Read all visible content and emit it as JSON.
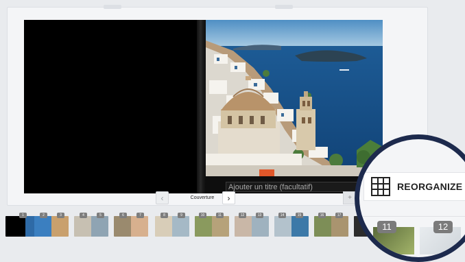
{
  "spread": {
    "title_placeholder": "Ajouter un titre (facultatif)"
  },
  "navigation": {
    "prev_icon": "chevron-left-icon",
    "next_icon": "chevron-right-icon",
    "page_label": "Couverture",
    "prev_glyph": "‹",
    "next_glyph": "›"
  },
  "add_page": {
    "icon": "add-page-icon",
    "glyph": "+"
  },
  "thumbnails": [
    {
      "left_num": "",
      "right_num": "1"
    },
    {
      "left_num": "2",
      "right_num": "3"
    },
    {
      "left_num": "4",
      "right_num": "5"
    },
    {
      "left_num": "6",
      "right_num": "7"
    },
    {
      "left_num": "8",
      "right_num": "9"
    },
    {
      "left_num": "10",
      "right_num": "11"
    },
    {
      "left_num": "12",
      "right_num": "13"
    },
    {
      "left_num": "14",
      "right_num": "15"
    },
    {
      "left_num": "16",
      "right_num": "17"
    },
    {
      "left_num": "18",
      "right_num": "19"
    }
  ],
  "zoom_callout": {
    "button_label": "REORGANIZE",
    "button_icon": "grid-icon",
    "thumb_left_num": "11",
    "thumb_right_num": "12"
  },
  "colors": {
    "background": "#e9ebee",
    "callout_ring": "#1d2a4d",
    "badge": "#7d7d7d"
  }
}
